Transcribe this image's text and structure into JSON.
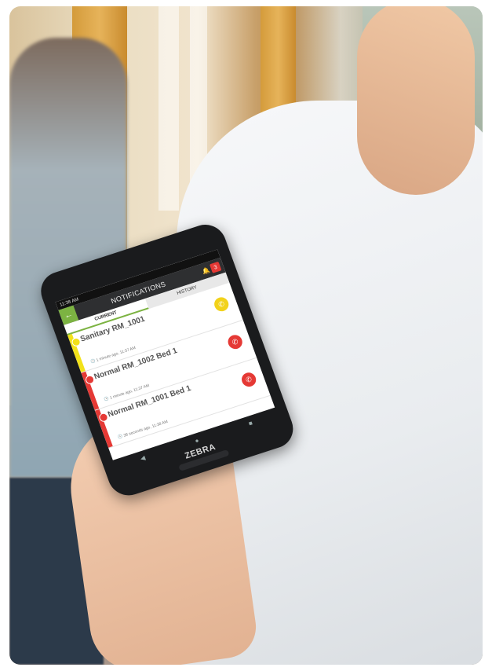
{
  "phone": {
    "status": {
      "time": "11:38 AM"
    },
    "app": {
      "title": "NOTIFICATIONS",
      "back_icon": "arrow-left-icon",
      "badge": "3",
      "tabs": [
        {
          "label": "CURRENT",
          "active": true
        },
        {
          "label": "HISTORY",
          "active": false
        }
      ],
      "notifications": [
        {
          "name": "Sanitary RM_1001",
          "time": "1 minute ago, 11:37 AM",
          "color": "#f2e21a",
          "call_color": "#f2d21a"
        },
        {
          "name": "Normal RM_1002 Bed 1",
          "time": "1 minute ago, 11:37 AM",
          "color": "#e53935",
          "call_color": "#e53935"
        },
        {
          "name": "Normal RM_1001 Bed 1",
          "time": "38 seconds ago, 11:38 AM",
          "color": "#e53935",
          "call_color": "#e53935"
        }
      ]
    },
    "nav": {
      "back": "◀",
      "home": "●",
      "recent": "■"
    },
    "brand": "ZEBRA"
  }
}
